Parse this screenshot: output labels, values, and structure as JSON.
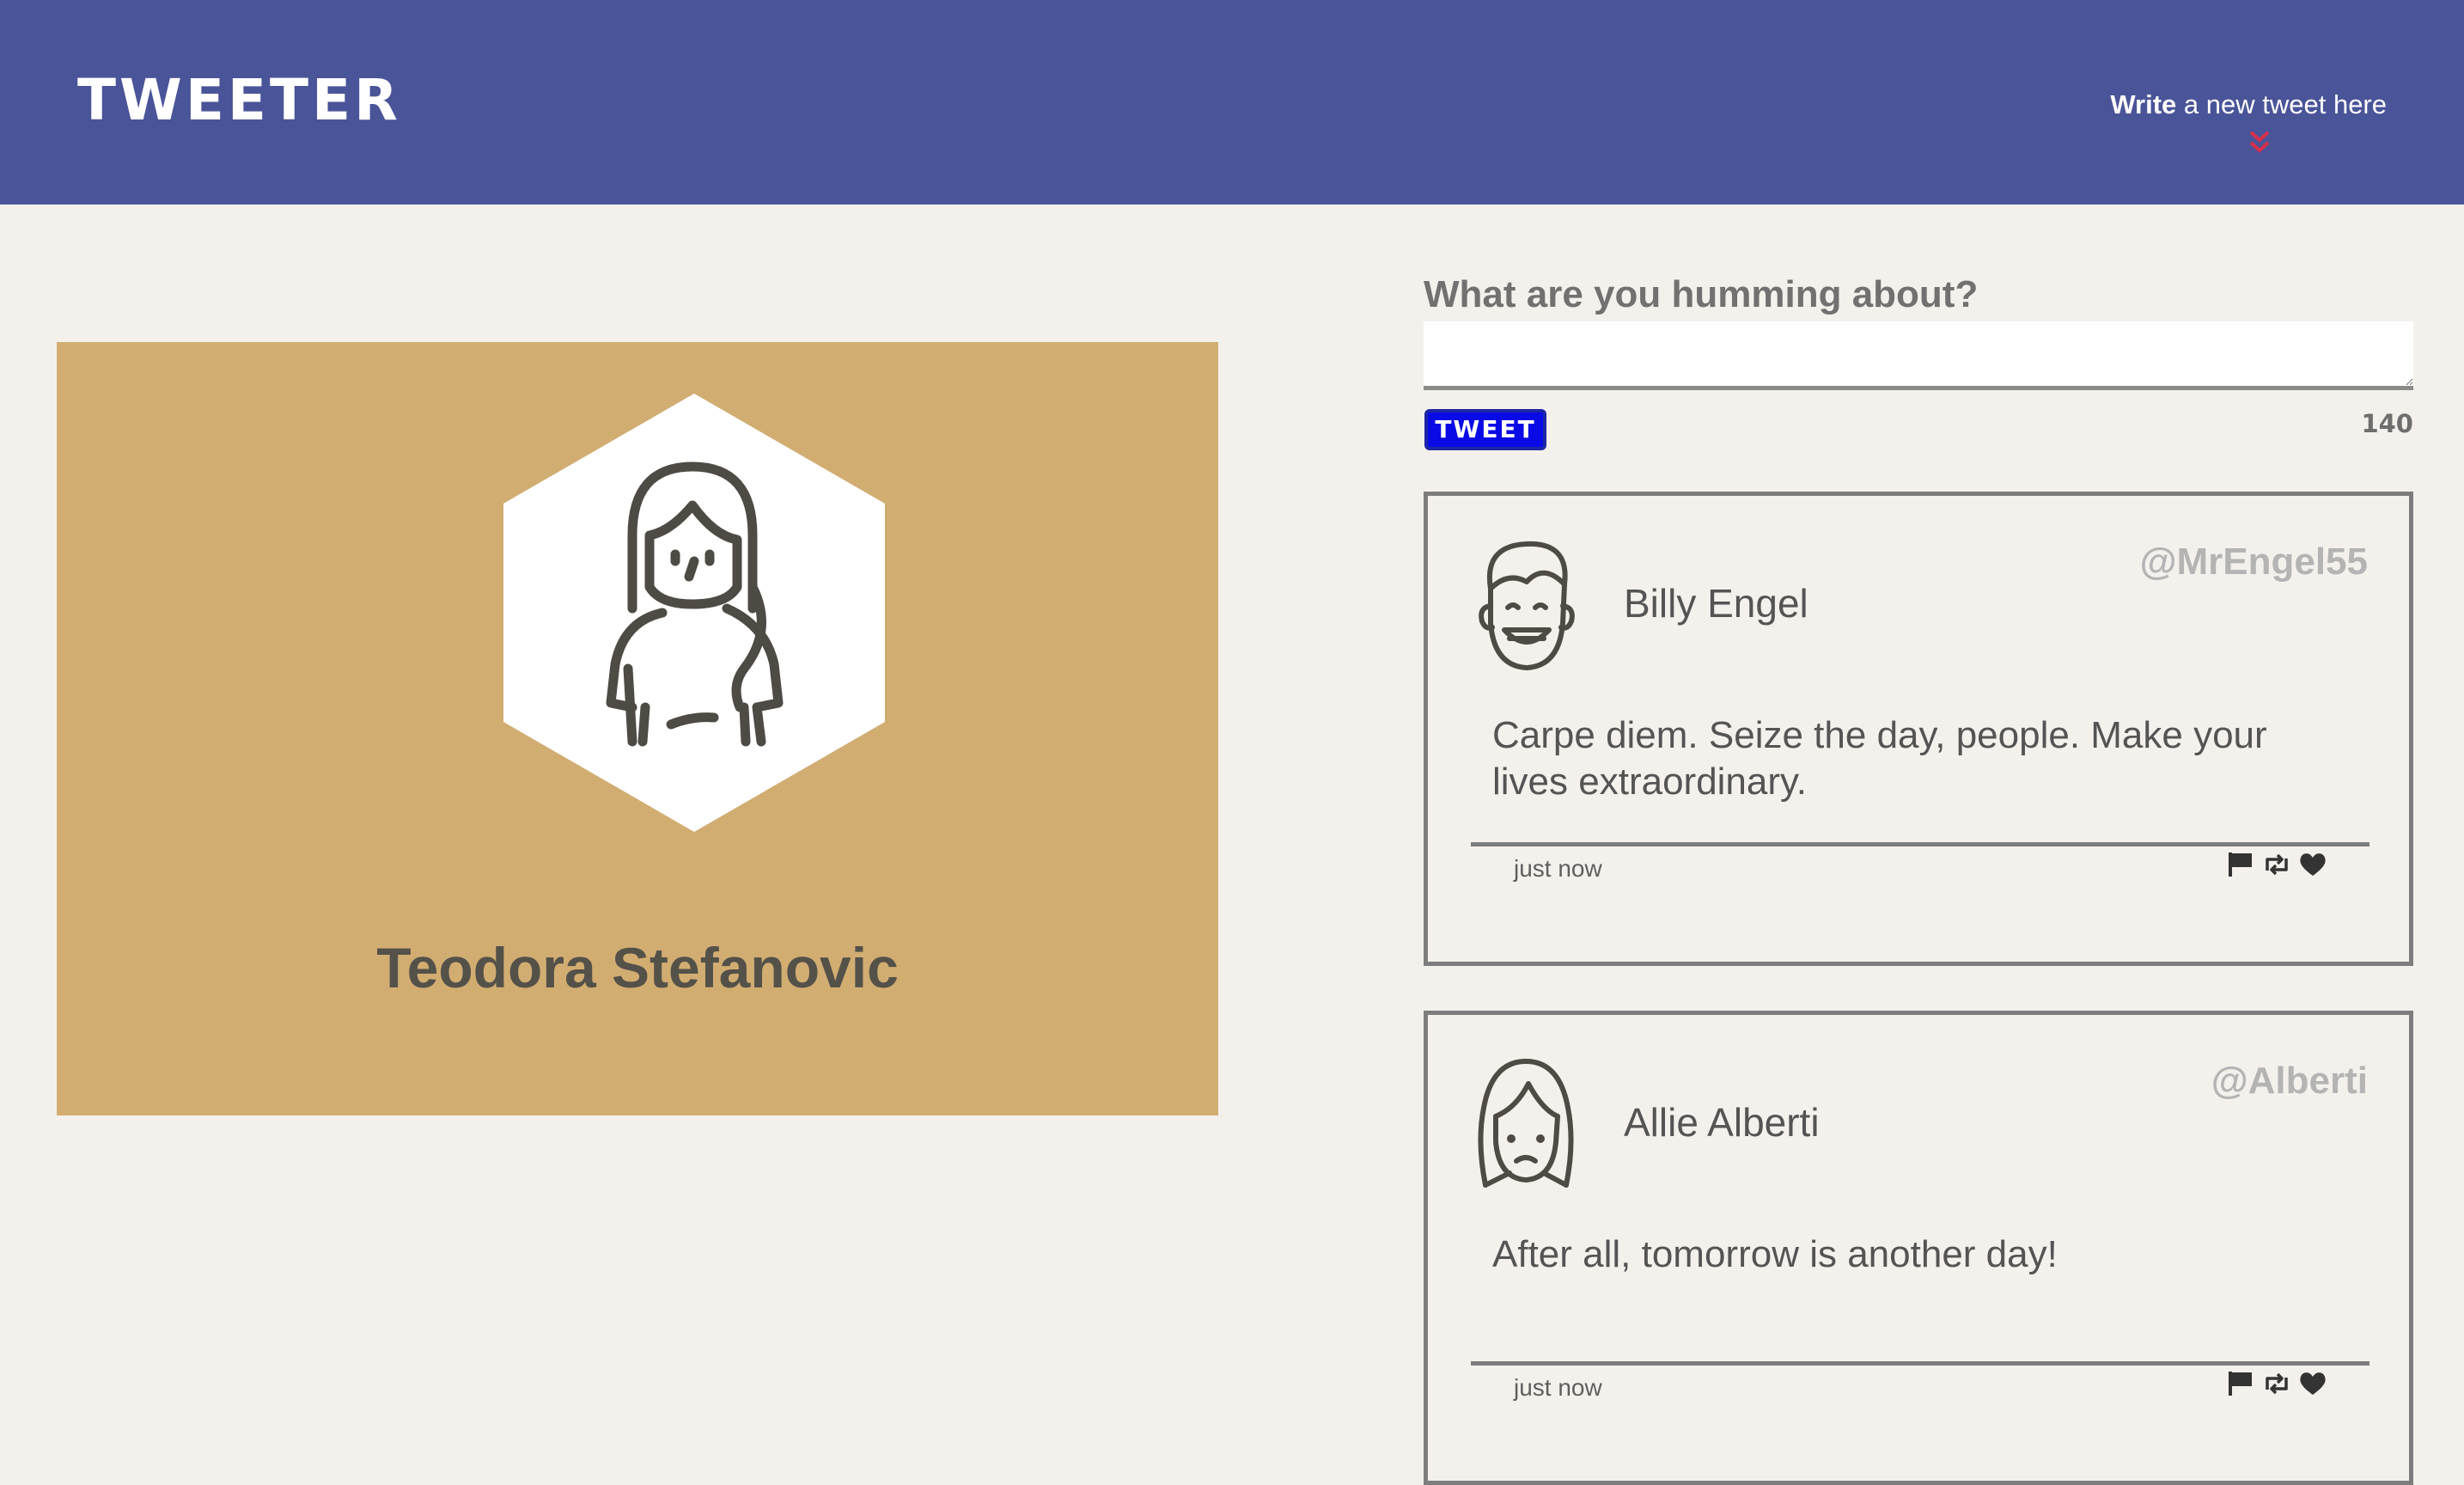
{
  "header": {
    "brand": "TWEETER",
    "compose_bold": "Write",
    "compose_rest": " a new tweet here",
    "icons": {
      "toggle": "double-chevron-down-icon"
    },
    "colors": {
      "nav_bg": "#4a5498",
      "chevron": "#d6304a"
    }
  },
  "profile": {
    "name": "Teodora Stefanovic",
    "avatar_icon": "woman-avatar-icon",
    "card_color": "#d2ad72"
  },
  "compose": {
    "label": "What are you humming about?",
    "placeholder": "",
    "value": "",
    "button": "TWEET",
    "counter": "140",
    "button_color": "#0a0ae6"
  },
  "tweets": [
    {
      "author": "Billy Engel",
      "handle": "@MrEngel55",
      "text": "Carpe diem. Seize the day, people. Make your lives extraordinary.",
      "time": "just now",
      "avatar_icon": "smiling-man-avatar-icon"
    },
    {
      "author": "Allie Alberti",
      "handle": "@Alberti",
      "text": "After all, tomorrow is another day!",
      "time": "just now",
      "avatar_icon": "frowning-woman-avatar-icon"
    }
  ],
  "tweet_action_icons": [
    "flag-icon",
    "retweet-icon",
    "heart-icon"
  ]
}
